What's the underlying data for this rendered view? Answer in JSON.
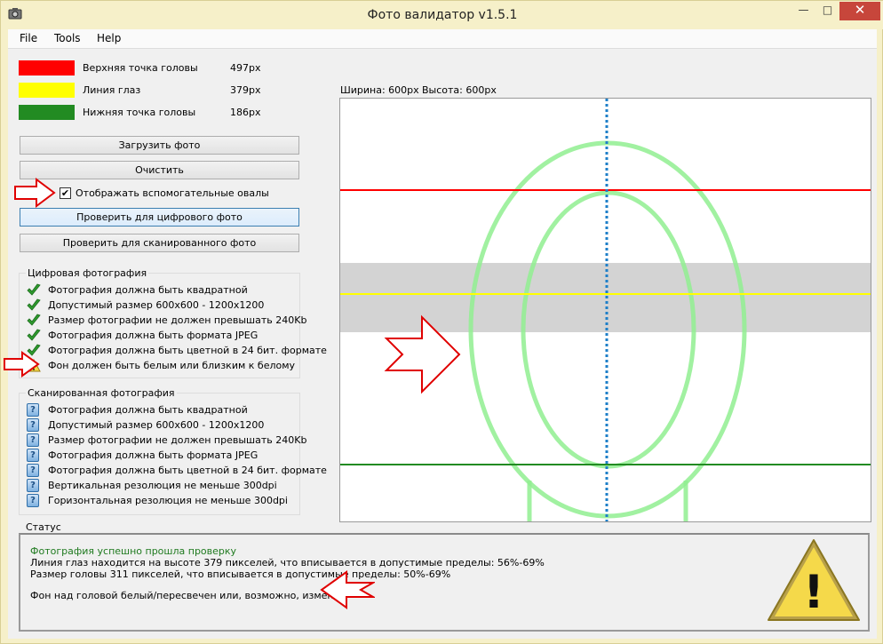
{
  "window": {
    "title": "Фото валидатор v1.5.1",
    "minimize": "—",
    "maximize": "□",
    "close": "✕"
  },
  "menu": [
    "File",
    "Tools",
    "Help"
  ],
  "legend": [
    {
      "color": "#ff0000",
      "label": "Верхняя точка головы",
      "value": "497px"
    },
    {
      "color": "#ffff00",
      "label": "Линия глаз",
      "value": "379px"
    },
    {
      "color": "#228b22",
      "label": "Нижняя точка головы",
      "value": "186px"
    }
  ],
  "buttons": {
    "load": "Загрузить фото",
    "clear": "Очистить",
    "check_digital": "Проверить для цифрового фото",
    "check_scanned": "Проверить для сканированного фото"
  },
  "show_ovals": {
    "label": "Отображать вспомогательные овалы",
    "checked": true,
    "mark": "✔"
  },
  "digital": {
    "title": "Цифровая фотография",
    "items": [
      {
        "icon": "checkmark-icon",
        "label": "Фотография должна быть квадратной"
      },
      {
        "icon": "checkmark-icon",
        "label": "Допустимый размер 600x600 - 1200x1200"
      },
      {
        "icon": "checkmark-icon",
        "label": "Размер фотографии не должен превышать 240Kb"
      },
      {
        "icon": "checkmark-icon",
        "label": "Фотография должна быть формата JPEG"
      },
      {
        "icon": "checkmark-icon",
        "label": "Фотография должна быть цветной в 24 бит. формате"
      },
      {
        "icon": "warning-icon",
        "label": "Фон должен быть белым или близким к белому"
      }
    ]
  },
  "scanned": {
    "title": "Сканированная фотография",
    "items": [
      {
        "icon": "question-icon",
        "label": "Фотография должна быть квадратной"
      },
      {
        "icon": "question-icon",
        "label": "Допустимый размер 600x600 - 1200x1200"
      },
      {
        "icon": "question-icon",
        "label": "Размер фотографии не должен превышать 240Kb"
      },
      {
        "icon": "question-icon",
        "label": "Фотография должна быть формата JPEG"
      },
      {
        "icon": "question-icon",
        "label": "Фотография должна быть цветной в 24 бит. формате"
      },
      {
        "icon": "question-icon",
        "label": "Вертикальная резолюция не меньше 300dpi"
      },
      {
        "icon": "question-icon",
        "label": "Горизонтальная резолюция не меньше 300dpi"
      }
    ],
    "question_mark": "?"
  },
  "image_info": {
    "width_label": "Ширина: 600px",
    "height_label": "Высота: 600px"
  },
  "status": {
    "title": "Статус",
    "success": "Фотография успешно прошла проверку",
    "eye_line": "Линия глаз находится на высоте 379 пикселей, что вписывается в допустимые пределы: 56%-69%",
    "head_size": "Размер головы 311 пикселей, что вписывается в допустимые пределы: 50%-69%",
    "background": "Фон над головой белый/пересвечен или, возможно, изменен",
    "warning_mark": "!"
  },
  "colors": {
    "head_top": "#ff0000",
    "eye_line": "#ffff00",
    "head_bottom": "#228b22",
    "oval": "#90ee90",
    "center_line": "#1e7fc8",
    "eye_band": "#d3d3d3",
    "annotation_arrow": "#e00000",
    "warning_yellow": "#f5d94a"
  }
}
